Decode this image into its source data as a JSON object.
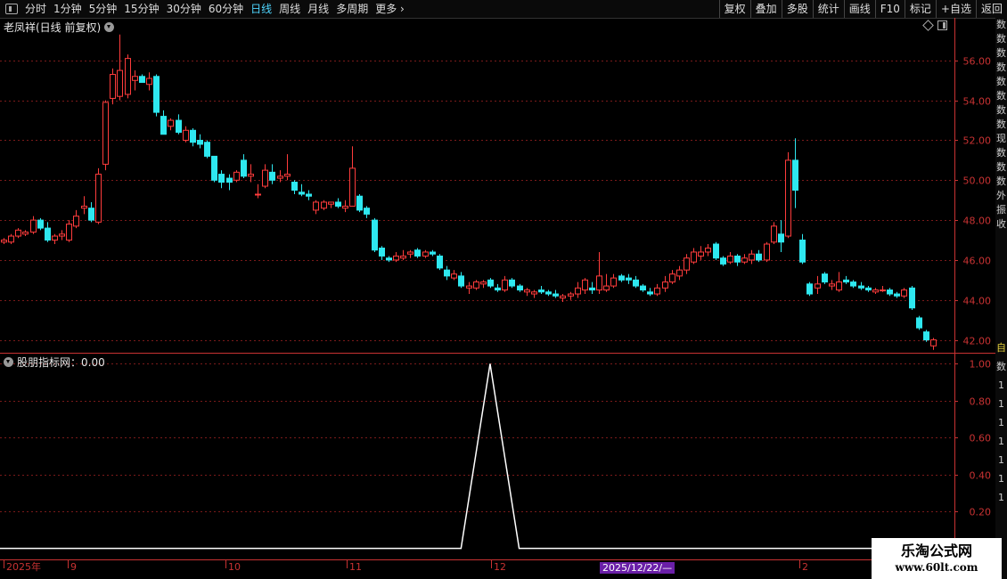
{
  "toolbar": {
    "periods": [
      "分时",
      "1分钟",
      "5分钟",
      "15分钟",
      "30分钟",
      "60分钟",
      "日线",
      "周线",
      "月线",
      "多周期",
      "更多"
    ],
    "active_period": "日线",
    "more_arrow": "chevron-right-icon",
    "right_buttons": [
      "复权",
      "叠加",
      "多股",
      "统计",
      "画线",
      "F10",
      "标记",
      "+自选",
      "返回"
    ]
  },
  "chart_title": "老凤祥(日线 前复权)",
  "indicator_title": "股朋指标网：0.00",
  "x_labels": [
    "2025年",
    "9",
    "10",
    "11",
    "12",
    "2"
  ],
  "selected_date": "2025/12/22/—",
  "watermark": {
    "line1": "乐淘公式网",
    "line2": "www.60lt.com"
  },
  "sidebar_chars": [
    "数",
    "数",
    "数",
    "数",
    "数",
    "数",
    "数",
    "数",
    "现",
    "数",
    "数",
    "数",
    "外",
    "振",
    "收"
  ],
  "sidebar_chars_lower": [
    "自",
    "数",
    "1",
    "1",
    "1",
    "1",
    "1",
    "1",
    "1"
  ],
  "colors": {
    "up": "#ff3c3c",
    "down": "#2ee8f0",
    "grid": "#7a1a1a",
    "axis": "#c83232",
    "line": "#ffffff"
  },
  "chart_data": [
    {
      "type": "candlestick",
      "title": "老凤祥(日线 前复权)",
      "y_ticks": [
        "56.00",
        "54.00",
        "52.00",
        "50.00",
        "48.00",
        "46.00",
        "44.00",
        "42.00"
      ],
      "ylim": [
        41.4,
        57.6
      ],
      "grid": true,
      "candles": [
        {
          "o": 46.9,
          "h": 47.1,
          "l": 46.8,
          "c": 47.0
        },
        {
          "o": 46.9,
          "h": 47.3,
          "l": 46.8,
          "c": 47.2
        },
        {
          "o": 47.2,
          "h": 47.6,
          "l": 47.1,
          "c": 47.5
        },
        {
          "o": 47.3,
          "h": 47.5,
          "l": 47.2,
          "c": 47.4
        },
        {
          "o": 47.4,
          "h": 48.2,
          "l": 47.3,
          "c": 48.0
        },
        {
          "o": 48.0,
          "h": 48.1,
          "l": 47.5,
          "c": 47.6
        },
        {
          "o": 47.6,
          "h": 47.9,
          "l": 46.9,
          "c": 47.0
        },
        {
          "o": 47.0,
          "h": 47.3,
          "l": 46.8,
          "c": 47.2
        },
        {
          "o": 47.2,
          "h": 47.5,
          "l": 47.0,
          "c": 47.3
        },
        {
          "o": 47.0,
          "h": 48.0,
          "l": 46.9,
          "c": 47.8
        },
        {
          "o": 47.7,
          "h": 48.5,
          "l": 47.6,
          "c": 48.2
        },
        {
          "o": 48.6,
          "h": 49.2,
          "l": 48.3,
          "c": 48.7
        },
        {
          "o": 48.6,
          "h": 48.9,
          "l": 47.9,
          "c": 48.0
        },
        {
          "o": 47.9,
          "h": 50.6,
          "l": 47.8,
          "c": 50.3
        },
        {
          "o": 50.8,
          "h": 54.0,
          "l": 50.5,
          "c": 53.9
        },
        {
          "o": 54.1,
          "h": 55.6,
          "l": 53.8,
          "c": 55.3
        },
        {
          "o": 54.2,
          "h": 57.3,
          "l": 54.0,
          "c": 55.5
        },
        {
          "o": 54.3,
          "h": 56.3,
          "l": 54.1,
          "c": 56.1
        },
        {
          "o": 55.0,
          "h": 55.5,
          "l": 54.5,
          "c": 55.2
        },
        {
          "o": 55.2,
          "h": 55.3,
          "l": 54.9,
          "c": 54.9
        },
        {
          "o": 54.8,
          "h": 55.4,
          "l": 54.5,
          "c": 55.1
        },
        {
          "o": 55.2,
          "h": 55.3,
          "l": 53.2,
          "c": 53.4
        },
        {
          "o": 53.2,
          "h": 53.5,
          "l": 52.3,
          "c": 52.3
        },
        {
          "o": 52.7,
          "h": 53.1,
          "l": 52.5,
          "c": 53.0
        },
        {
          "o": 53.0,
          "h": 53.3,
          "l": 52.3,
          "c": 52.4
        },
        {
          "o": 52.0,
          "h": 52.7,
          "l": 51.9,
          "c": 52.5
        },
        {
          "o": 52.5,
          "h": 52.6,
          "l": 51.7,
          "c": 51.9
        },
        {
          "o": 52.0,
          "h": 52.3,
          "l": 51.6,
          "c": 51.8
        },
        {
          "o": 51.9,
          "h": 52.0,
          "l": 51.1,
          "c": 51.2
        },
        {
          "o": 51.2,
          "h": 51.2,
          "l": 49.9,
          "c": 50.0
        },
        {
          "o": 50.3,
          "h": 50.5,
          "l": 49.6,
          "c": 49.9
        },
        {
          "o": 50.1,
          "h": 50.3,
          "l": 49.5,
          "c": 49.9
        },
        {
          "o": 50.0,
          "h": 50.5,
          "l": 49.9,
          "c": 50.4
        },
        {
          "o": 51.0,
          "h": 51.3,
          "l": 50.1,
          "c": 50.2
        },
        {
          "o": 50.2,
          "h": 50.8,
          "l": 49.9,
          "c": 50.3
        },
        {
          "o": 49.3,
          "h": 49.8,
          "l": 49.1,
          "c": 49.3
        },
        {
          "o": 49.7,
          "h": 50.8,
          "l": 49.6,
          "c": 50.5
        },
        {
          "o": 50.4,
          "h": 50.8,
          "l": 49.8,
          "c": 50.0
        },
        {
          "o": 50.1,
          "h": 50.5,
          "l": 49.9,
          "c": 50.2
        },
        {
          "o": 50.2,
          "h": 51.3,
          "l": 50.0,
          "c": 50.3
        },
        {
          "o": 49.9,
          "h": 50.0,
          "l": 49.3,
          "c": 49.5
        },
        {
          "o": 49.4,
          "h": 49.8,
          "l": 49.2,
          "c": 49.3
        },
        {
          "o": 49.3,
          "h": 49.5,
          "l": 49.0,
          "c": 49.2
        },
        {
          "o": 48.5,
          "h": 49.0,
          "l": 48.3,
          "c": 48.9
        },
        {
          "o": 48.6,
          "h": 49.0,
          "l": 48.5,
          "c": 48.9
        },
        {
          "o": 48.8,
          "h": 48.9,
          "l": 48.6,
          "c": 48.9
        },
        {
          "o": 48.9,
          "h": 49.1,
          "l": 48.6,
          "c": 48.7
        },
        {
          "o": 48.6,
          "h": 49.0,
          "l": 48.4,
          "c": 48.7
        },
        {
          "o": 48.7,
          "h": 51.7,
          "l": 48.7,
          "c": 50.6
        },
        {
          "o": 49.2,
          "h": 49.3,
          "l": 48.4,
          "c": 48.5
        },
        {
          "o": 48.6,
          "h": 48.7,
          "l": 48.1,
          "c": 48.3
        },
        {
          "o": 48.0,
          "h": 48.1,
          "l": 46.4,
          "c": 46.5
        },
        {
          "o": 46.6,
          "h": 46.7,
          "l": 46.0,
          "c": 46.2
        },
        {
          "o": 46.1,
          "h": 46.2,
          "l": 45.9,
          "c": 46.0
        },
        {
          "o": 46.0,
          "h": 46.4,
          "l": 45.9,
          "c": 46.2
        },
        {
          "o": 46.1,
          "h": 46.5,
          "l": 46.0,
          "c": 46.2
        },
        {
          "o": 46.3,
          "h": 46.5,
          "l": 46.1,
          "c": 46.4
        },
        {
          "o": 46.5,
          "h": 46.6,
          "l": 46.1,
          "c": 46.2
        },
        {
          "o": 46.2,
          "h": 46.5,
          "l": 46.1,
          "c": 46.4
        },
        {
          "o": 46.4,
          "h": 46.5,
          "l": 46.2,
          "c": 46.3
        },
        {
          "o": 46.2,
          "h": 46.3,
          "l": 45.5,
          "c": 45.6
        },
        {
          "o": 45.5,
          "h": 45.7,
          "l": 45.0,
          "c": 45.2
        },
        {
          "o": 45.1,
          "h": 45.5,
          "l": 45.0,
          "c": 45.3
        },
        {
          "o": 45.2,
          "h": 45.4,
          "l": 44.6,
          "c": 44.7
        },
        {
          "o": 44.6,
          "h": 44.9,
          "l": 44.3,
          "c": 44.7
        },
        {
          "o": 44.6,
          "h": 45.0,
          "l": 44.5,
          "c": 44.9
        },
        {
          "o": 44.8,
          "h": 45.0,
          "l": 44.6,
          "c": 44.9
        },
        {
          "o": 45.0,
          "h": 45.1,
          "l": 44.6,
          "c": 44.7
        },
        {
          "o": 44.6,
          "h": 44.8,
          "l": 44.4,
          "c": 44.5
        },
        {
          "o": 44.5,
          "h": 45.2,
          "l": 44.4,
          "c": 45.0
        },
        {
          "o": 45.0,
          "h": 45.1,
          "l": 44.6,
          "c": 44.7
        },
        {
          "o": 44.7,
          "h": 44.8,
          "l": 44.4,
          "c": 44.5
        },
        {
          "o": 44.4,
          "h": 44.6,
          "l": 44.2,
          "c": 44.5
        },
        {
          "o": 44.3,
          "h": 44.5,
          "l": 44.1,
          "c": 44.4
        },
        {
          "o": 44.5,
          "h": 44.7,
          "l": 44.3,
          "c": 44.4
        },
        {
          "o": 44.4,
          "h": 44.5,
          "l": 44.2,
          "c": 44.3
        },
        {
          "o": 44.3,
          "h": 44.5,
          "l": 44.1,
          "c": 44.2
        },
        {
          "o": 44.1,
          "h": 44.3,
          "l": 43.9,
          "c": 44.2
        },
        {
          "o": 44.2,
          "h": 44.4,
          "l": 44.0,
          "c": 44.3
        },
        {
          "o": 44.3,
          "h": 44.9,
          "l": 44.1,
          "c": 44.6
        },
        {
          "o": 44.5,
          "h": 45.1,
          "l": 44.3,
          "c": 45.0
        },
        {
          "o": 44.6,
          "h": 44.9,
          "l": 44.3,
          "c": 44.5
        },
        {
          "o": 44.5,
          "h": 46.4,
          "l": 44.3,
          "c": 45.2
        },
        {
          "o": 44.5,
          "h": 45.3,
          "l": 44.4,
          "c": 44.7
        },
        {
          "o": 44.7,
          "h": 45.3,
          "l": 44.6,
          "c": 45.1
        },
        {
          "o": 45.2,
          "h": 45.3,
          "l": 44.9,
          "c": 45.0
        },
        {
          "o": 45.1,
          "h": 45.3,
          "l": 44.8,
          "c": 45.0
        },
        {
          "o": 45.0,
          "h": 45.2,
          "l": 44.6,
          "c": 44.7
        },
        {
          "o": 44.7,
          "h": 44.8,
          "l": 44.4,
          "c": 44.5
        },
        {
          "o": 44.4,
          "h": 44.6,
          "l": 44.2,
          "c": 44.3
        },
        {
          "o": 44.3,
          "h": 44.8,
          "l": 44.2,
          "c": 44.6
        },
        {
          "o": 44.6,
          "h": 45.2,
          "l": 44.4,
          "c": 44.9
        },
        {
          "o": 44.9,
          "h": 45.5,
          "l": 44.8,
          "c": 45.3
        },
        {
          "o": 45.2,
          "h": 45.7,
          "l": 45.0,
          "c": 45.5
        },
        {
          "o": 45.5,
          "h": 46.3,
          "l": 45.3,
          "c": 46.1
        },
        {
          "o": 45.9,
          "h": 46.6,
          "l": 45.8,
          "c": 46.4
        },
        {
          "o": 46.2,
          "h": 46.7,
          "l": 46.0,
          "c": 46.4
        },
        {
          "o": 46.4,
          "h": 46.8,
          "l": 46.2,
          "c": 46.6
        },
        {
          "o": 46.8,
          "h": 46.9,
          "l": 46.0,
          "c": 46.1
        },
        {
          "o": 46.1,
          "h": 46.2,
          "l": 45.7,
          "c": 45.8
        },
        {
          "o": 45.9,
          "h": 46.4,
          "l": 45.8,
          "c": 46.2
        },
        {
          "o": 46.2,
          "h": 46.3,
          "l": 45.7,
          "c": 45.9
        },
        {
          "o": 45.9,
          "h": 46.3,
          "l": 45.8,
          "c": 46.1
        },
        {
          "o": 46.0,
          "h": 46.5,
          "l": 45.8,
          "c": 46.3
        },
        {
          "o": 46.3,
          "h": 46.5,
          "l": 45.9,
          "c": 46.0
        },
        {
          "o": 46.0,
          "h": 46.9,
          "l": 45.9,
          "c": 46.8
        },
        {
          "o": 46.9,
          "h": 47.9,
          "l": 46.8,
          "c": 47.7
        },
        {
          "o": 47.3,
          "h": 48.0,
          "l": 46.4,
          "c": 46.9
        },
        {
          "o": 47.2,
          "h": 51.4,
          "l": 47.1,
          "c": 51.0
        },
        {
          "o": 51.0,
          "h": 52.1,
          "l": 48.6,
          "c": 49.5
        },
        {
          "o": 47.0,
          "h": 47.3,
          "l": 45.8,
          "c": 45.9
        },
        {
          "o": 44.8,
          "h": 44.9,
          "l": 44.2,
          "c": 44.3
        },
        {
          "o": 44.6,
          "h": 45.2,
          "l": 44.3,
          "c": 44.8
        },
        {
          "o": 45.3,
          "h": 45.4,
          "l": 44.8,
          "c": 44.9
        },
        {
          "o": 44.7,
          "h": 45.0,
          "l": 44.5,
          "c": 44.8
        },
        {
          "o": 44.5,
          "h": 45.4,
          "l": 44.4,
          "c": 44.9
        },
        {
          "o": 45.0,
          "h": 45.2,
          "l": 44.8,
          "c": 44.9
        },
        {
          "o": 44.9,
          "h": 45.0,
          "l": 44.6,
          "c": 44.7
        },
        {
          "o": 44.7,
          "h": 44.9,
          "l": 44.5,
          "c": 44.6
        },
        {
          "o": 44.6,
          "h": 44.7,
          "l": 44.4,
          "c": 44.5
        },
        {
          "o": 44.4,
          "h": 44.6,
          "l": 44.3,
          "c": 44.5
        },
        {
          "o": 44.5,
          "h": 44.7,
          "l": 44.4,
          "c": 44.5
        },
        {
          "o": 44.5,
          "h": 44.6,
          "l": 44.2,
          "c": 44.3
        },
        {
          "o": 44.3,
          "h": 44.4,
          "l": 44.1,
          "c": 44.2
        },
        {
          "o": 44.2,
          "h": 44.6,
          "l": 44.1,
          "c": 44.5
        },
        {
          "o": 44.6,
          "h": 44.7,
          "l": 43.5,
          "c": 43.6
        },
        {
          "o": 43.1,
          "h": 43.2,
          "l": 42.5,
          "c": 42.6
        },
        {
          "o": 42.4,
          "h": 42.5,
          "l": 41.9,
          "c": 42.0
        },
        {
          "o": 41.7,
          "h": 42.1,
          "l": 41.5,
          "c": 42.0
        }
      ]
    },
    {
      "type": "line",
      "title": "股朋指标网：0.00",
      "y_ticks": [
        "1.00",
        "0.80",
        "0.60",
        "0.40",
        "0.20"
      ],
      "ylim": [
        -0.05,
        1.05
      ],
      "series": [
        {
          "name": "股朋指标网",
          "points": [
            [
              63,
              0
            ],
            [
              67,
              1.0
            ],
            [
              71,
              0
            ]
          ],
          "total": 139
        }
      ]
    }
  ]
}
